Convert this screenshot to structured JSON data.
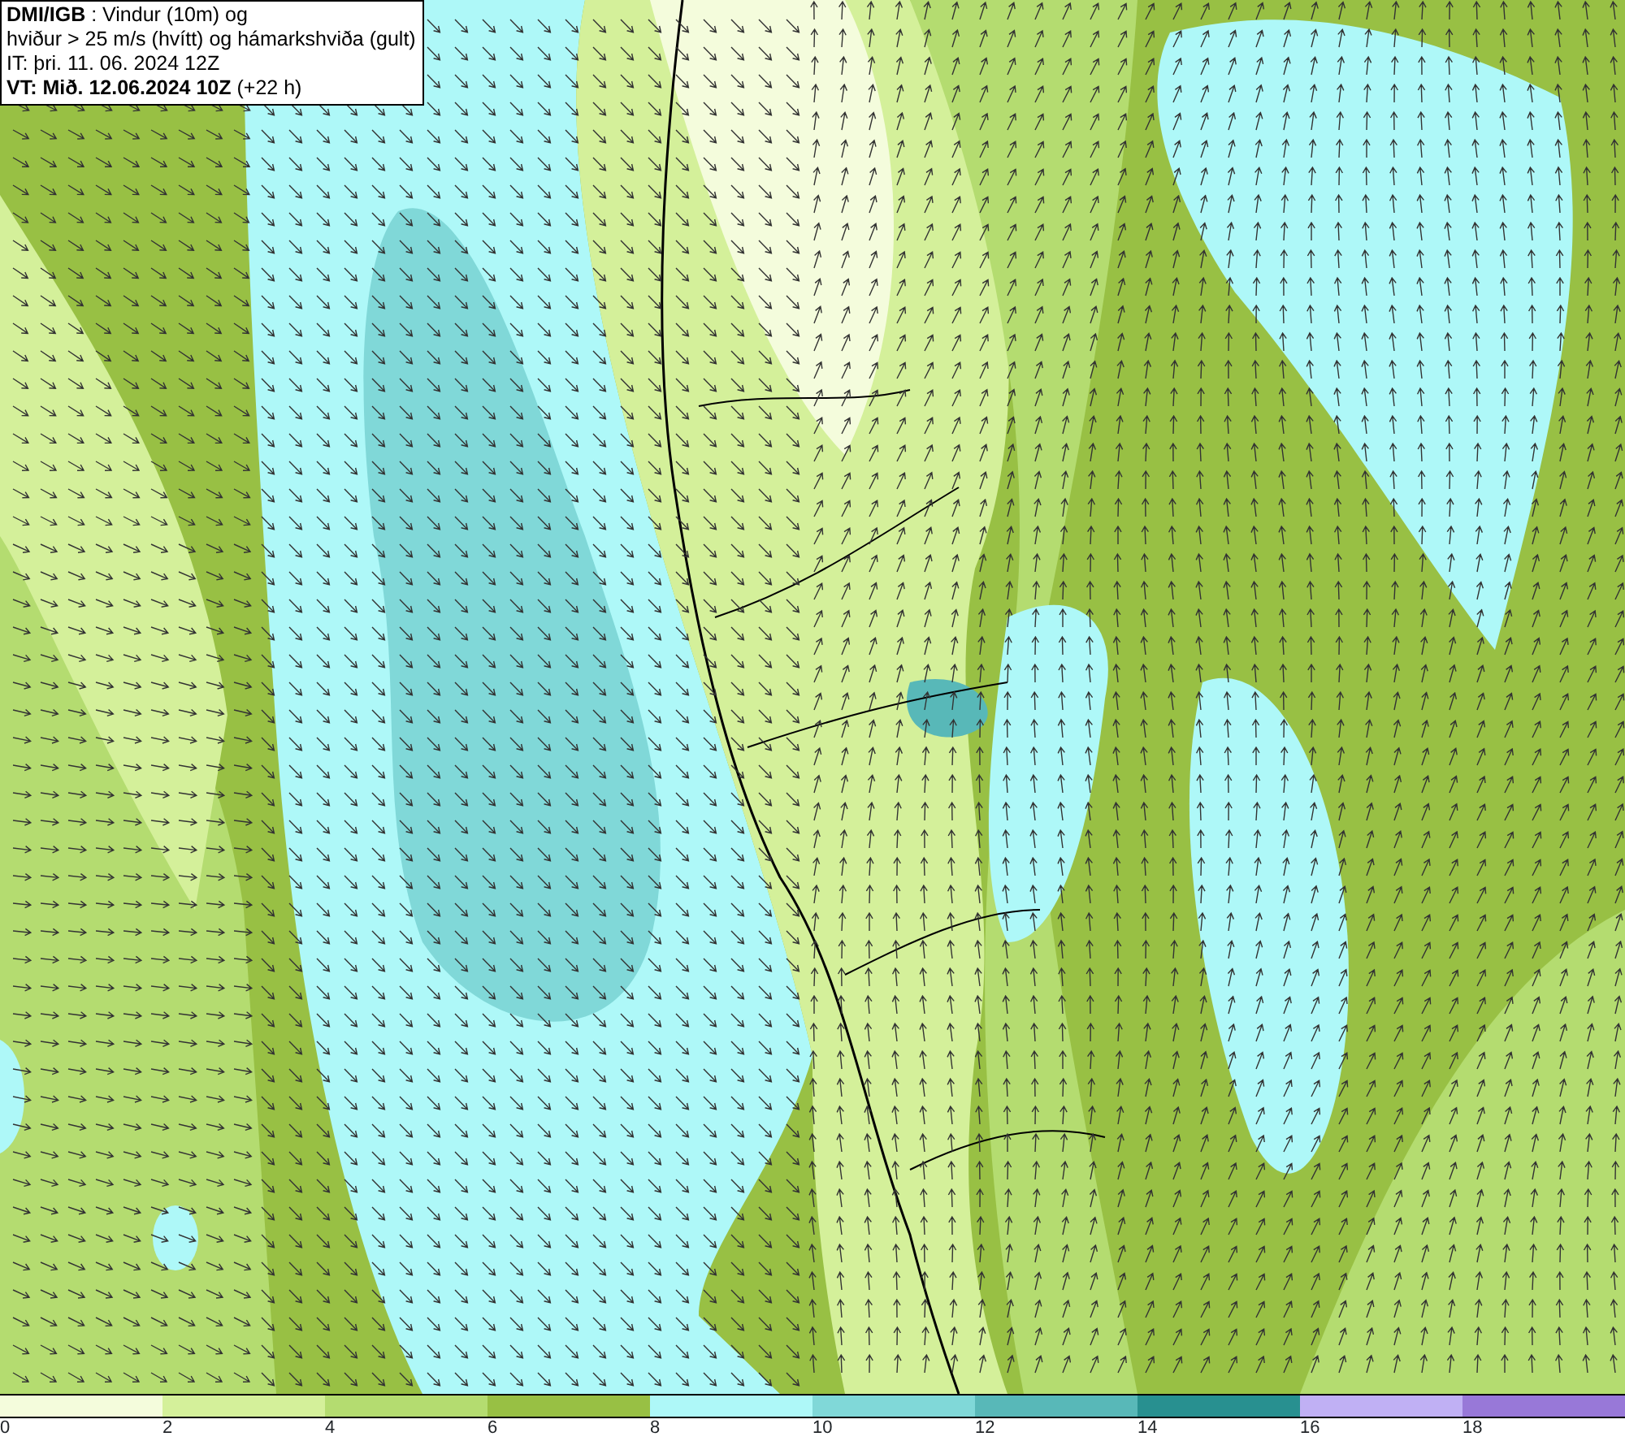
{
  "info_box": {
    "lines": [
      "**DMI/IGB** : Vindur (10m) og",
      "hviður > 25 m/s (hvítt) og hámarkshviða (gult)",
      "IT: þri. 11. 06. 2024 12Z",
      "**VT: Mið. 12.06.2024 10Z** (+22 h)"
    ]
  },
  "legend": {
    "bins": [
      {
        "color": "#f4fcdc"
      },
      {
        "color": "#d4f09a"
      },
      {
        "color": "#b4dc70"
      },
      {
        "color": "#98c044"
      },
      {
        "color": "#aef8f8"
      },
      {
        "color": "#80d8d8"
      },
      {
        "color": "#58b8b8"
      },
      {
        "color": "#289090"
      },
      {
        "color": "#c0b0f4"
      },
      {
        "color": "#9878d8"
      }
    ],
    "ticks": [
      "0",
      "2",
      "4",
      "6",
      "8",
      "10",
      "12",
      "14",
      "16",
      "18"
    ]
  }
}
